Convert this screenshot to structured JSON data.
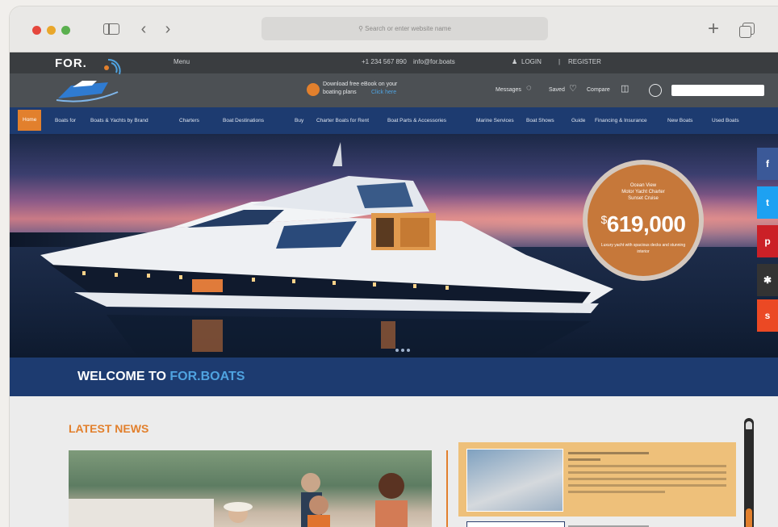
{
  "browser": {
    "address_placeholder": "Search or enter website name"
  },
  "site": {
    "logo": "FOR.",
    "topbar": {
      "menu_label": "Menu",
      "phone": "+1 234 567 890",
      "email": "info@for.boats",
      "login": "LOGIN",
      "register": "REGISTER"
    },
    "header": {
      "promo_line1": "Download free eBook on your",
      "promo_line2": "boating plans",
      "promo_link": "Click here",
      "messages": "Messages",
      "saved": "Saved",
      "compare": "Compare"
    },
    "nav": [
      "Home",
      "Boats for",
      "Boats & Yachts by Brand",
      "Charters",
      "Boat Destinations",
      "Buy",
      "Charter Boats for Rent",
      "Boat Parts & Accessories",
      "Marine Services",
      "Boat Shows",
      "Guide",
      "Financing & Insurance",
      "New Boats",
      "Used Boats"
    ],
    "hero": {
      "price_line1": "Ocean View",
      "price_line2": "Motor Yacht Charter",
      "price_line3": "Sunset Cruise",
      "price": "619,000",
      "currency": "$",
      "price_note": "Luxury yacht with spacious decks and stunning interior"
    },
    "social": [
      {
        "icon": "facebook-icon",
        "glyph": "f",
        "color": "#3b5998"
      },
      {
        "icon": "twitter-icon",
        "glyph": "t",
        "color": "#1da1f2"
      },
      {
        "icon": "pinterest-icon",
        "glyph": "p",
        "color": "#cb2027"
      },
      {
        "icon": "share-icon",
        "glyph": "✱",
        "color": "#333333"
      },
      {
        "icon": "stumbleupon-icon",
        "glyph": "su",
        "color": "#eb4924"
      }
    ],
    "welcome_prefix": "WELCOME TO",
    "welcome_brand": "FOR.BOATS",
    "latest_news": "LATEST NEWS"
  },
  "colors": {
    "accent": "#e2802d",
    "navy": "#1d3b70",
    "header_dark": "#3a3d40"
  }
}
